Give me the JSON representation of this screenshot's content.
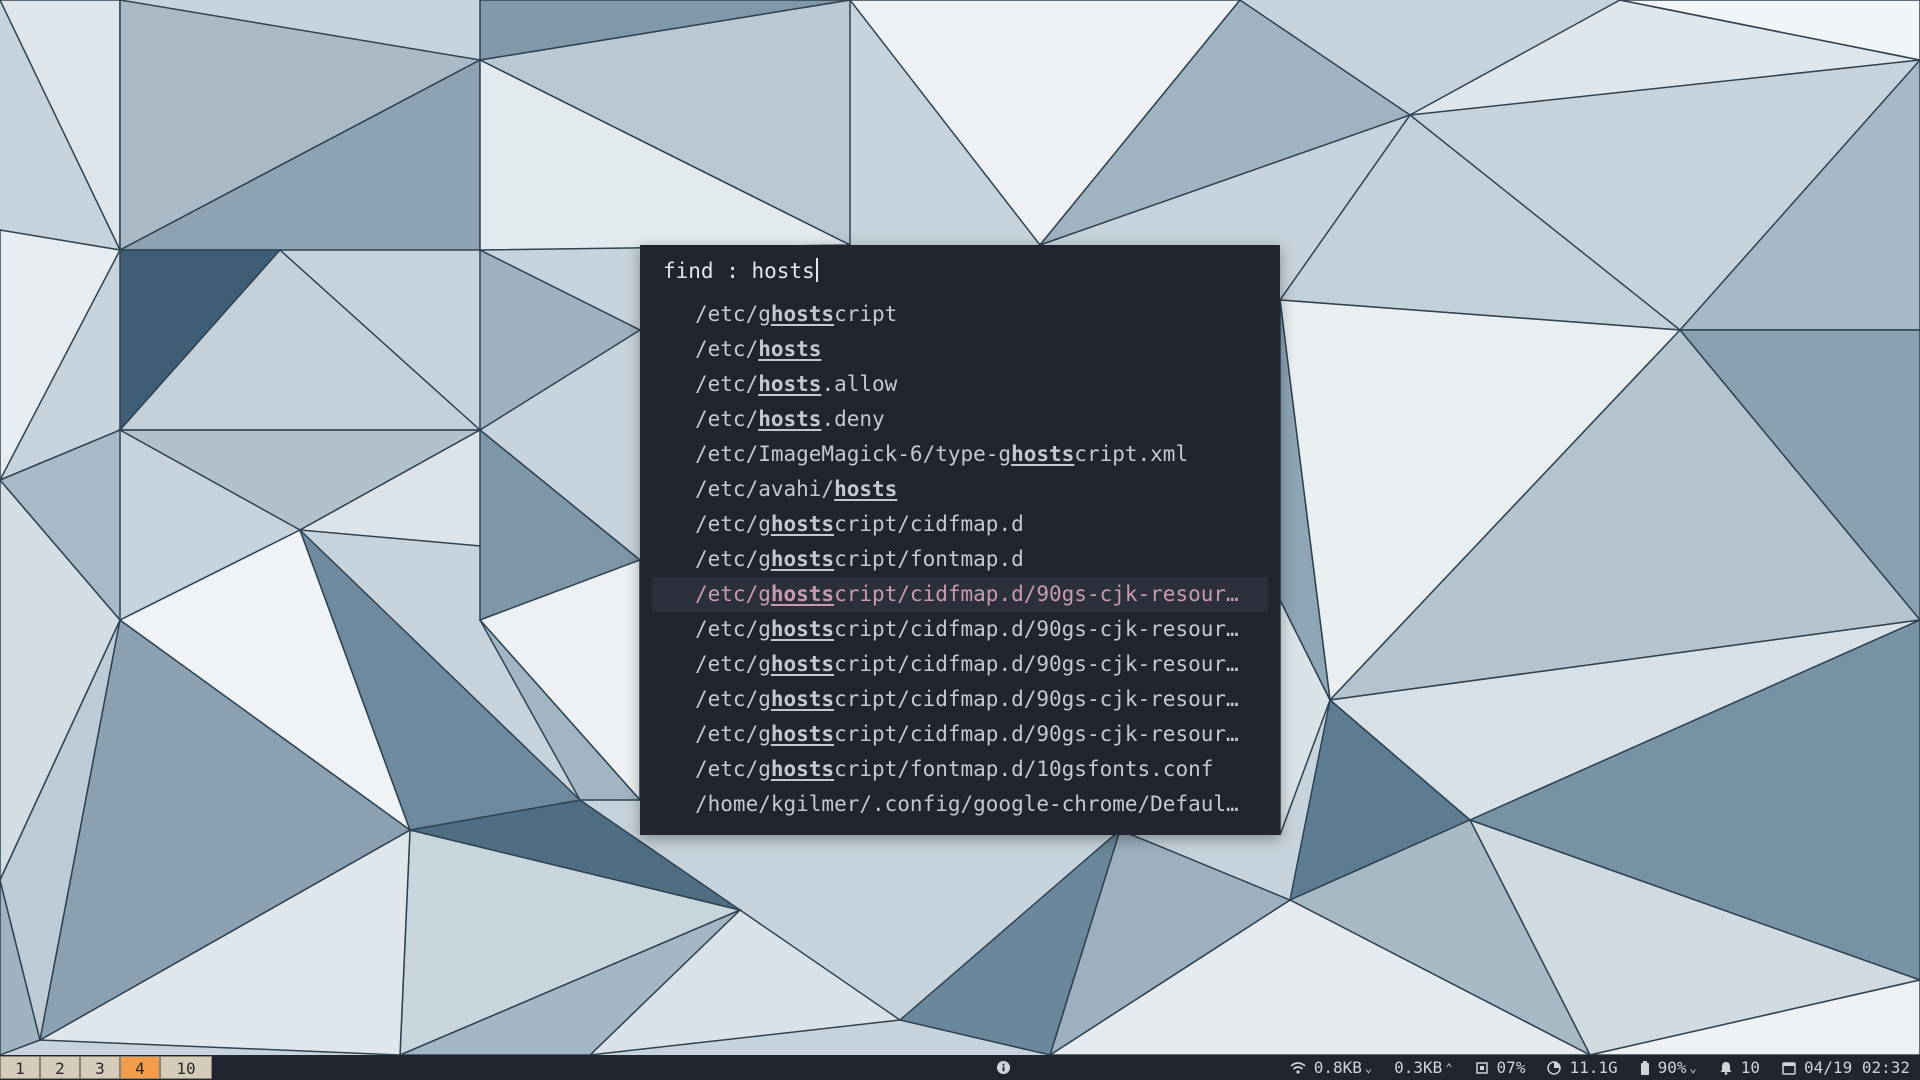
{
  "launcher": {
    "prompt_label": "find :",
    "query": "hosts",
    "results": [
      {
        "pre": "/etc/g",
        "match": "hosts",
        "post": "cript"
      },
      {
        "pre": "/etc/",
        "match": "hosts",
        "post": ""
      },
      {
        "pre": "/etc/",
        "match": "hosts",
        "post": ".allow"
      },
      {
        "pre": "/etc/",
        "match": "hosts",
        "post": ".deny"
      },
      {
        "pre": "/etc/ImageMagick-6/type-g",
        "match": "hosts",
        "post": "cript.xml"
      },
      {
        "pre": "/etc/avahi/",
        "match": "hosts",
        "post": ""
      },
      {
        "pre": "/etc/g",
        "match": "hosts",
        "post": "cript/cidfmap.d"
      },
      {
        "pre": "/etc/g",
        "match": "hosts",
        "post": "cript/fontmap.d"
      },
      {
        "pre": "/etc/g",
        "match": "hosts",
        "post": "cript/cidfmap.d/90gs-cjk-resour…"
      },
      {
        "pre": "/etc/g",
        "match": "hosts",
        "post": "cript/cidfmap.d/90gs-cjk-resour…"
      },
      {
        "pre": "/etc/g",
        "match": "hosts",
        "post": "cript/cidfmap.d/90gs-cjk-resour…"
      },
      {
        "pre": "/etc/g",
        "match": "hosts",
        "post": "cript/cidfmap.d/90gs-cjk-resour…"
      },
      {
        "pre": "/etc/g",
        "match": "hosts",
        "post": "cript/cidfmap.d/90gs-cjk-resour…"
      },
      {
        "pre": "/etc/g",
        "match": "hosts",
        "post": "cript/fontmap.d/10gsfonts.conf"
      },
      {
        "pre": "/home/kgilmer/.config/google-chrome/Defaul…",
        "match": "",
        "post": ""
      }
    ],
    "selected_index": 8
  },
  "bar": {
    "workspaces": [
      {
        "label": "1",
        "active": false
      },
      {
        "label": "2",
        "active": false
      },
      {
        "label": "3",
        "active": false
      },
      {
        "label": "4",
        "active": true
      },
      {
        "label": "10",
        "active": false
      }
    ],
    "net_down": "0.8KB",
    "net_up": "0.3KB",
    "cpu": "07%",
    "memory": "11.1G",
    "battery": "90%",
    "notifications": "10",
    "datetime": "04/19 02:32"
  },
  "colors": {
    "panel_bg": "#212530",
    "selected_text": "#c99ab4",
    "active_workspace": "#f39d4b"
  }
}
